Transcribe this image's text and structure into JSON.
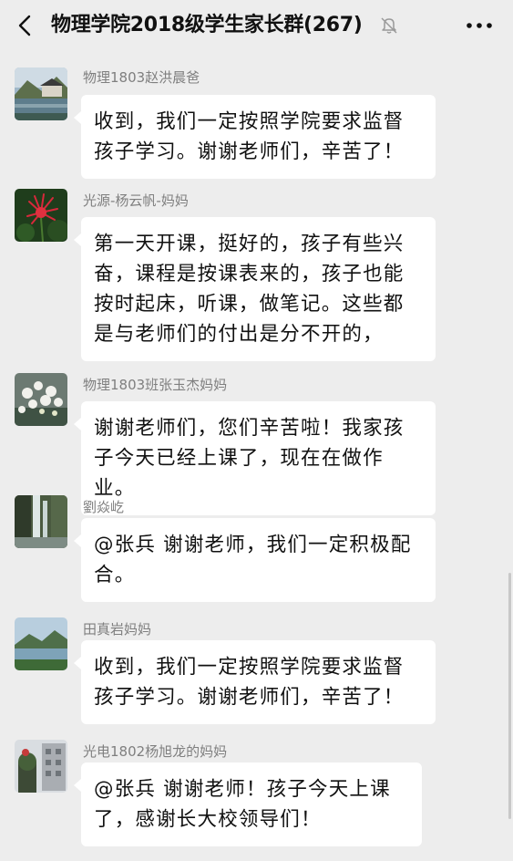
{
  "header": {
    "title": "物理学院2018级学生家长群(267)",
    "back_icon": "chevron-left-icon",
    "mute_icon": "bell-off-icon",
    "more_icon": "more-dots-icon"
  },
  "messages": [
    {
      "sender": "物理1803赵洪晨爸",
      "text": "收到，我们一定按照学院要求监督孩子学习。谢谢老师们，辛苦了！",
      "avatar_icon": "landscape-house-avatar"
    },
    {
      "sender": "光源-杨云帆-妈妈",
      "text": "第一天开课，挺好的，孩子有些兴奋，课程是按课表来的，孩子也能按时起床，听课，做笔记。这些都是与老师们的付出是分不开的，",
      "avatar_icon": "red-flower-avatar"
    },
    {
      "sender": "物理1803班张玉杰妈妈",
      "text": "谢谢老师们，您们辛苦啦！我家孩子今天已经上课了，现在在做作业。",
      "avatar_icon": "white-flowers-avatar"
    },
    {
      "sender": "劉焱屹",
      "text": "@张兵  谢谢老师，我们一定积极配合。",
      "avatar_icon": "waterfall-avatar"
    },
    {
      "sender": "田真岩妈妈",
      "text": "收到，我们一定按照学院要求监督孩子学习。谢谢老师们，辛苦了！",
      "avatar_icon": "lake-mountain-avatar"
    },
    {
      "sender": "光电1802杨旭龙的妈妈",
      "text": "@张兵  谢谢老师！孩子今天上课了，感谢长大校领导们！",
      "avatar_icon": "building-photo-avatar"
    }
  ]
}
